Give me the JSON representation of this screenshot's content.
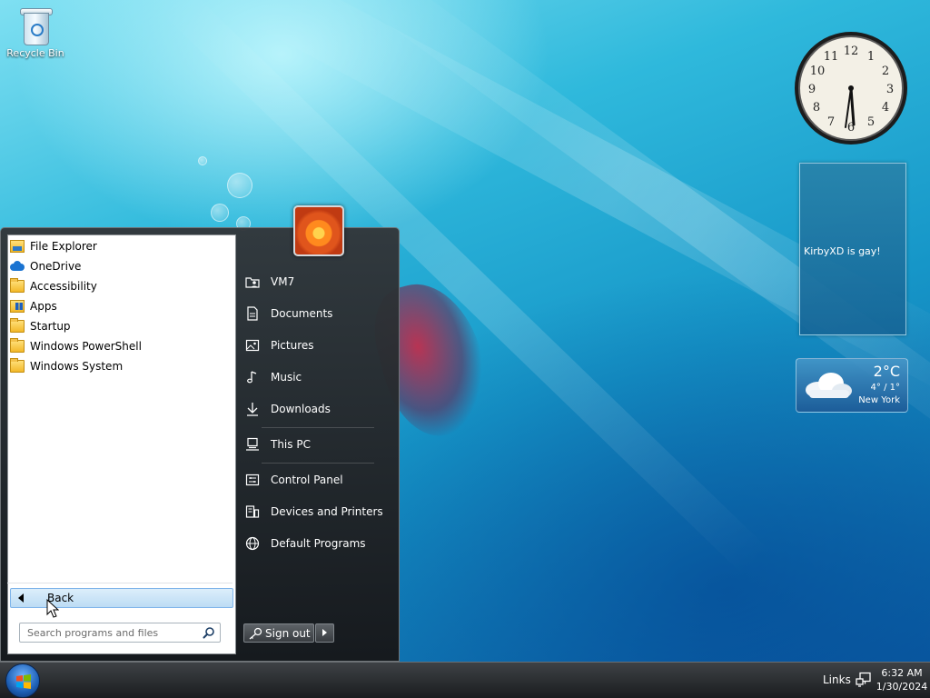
{
  "desktop": {
    "recycle_bin_label": "Recycle Bin",
    "note_text": "KirbyXD is gay!",
    "weather": {
      "temp": "2°C",
      "range": "4° / 1°",
      "city": "New York"
    }
  },
  "start_menu": {
    "programs": [
      {
        "label": "File Explorer",
        "icon": "file-explorer-icon"
      },
      {
        "label": "OneDrive",
        "icon": "onedrive-icon"
      },
      {
        "label": "Accessibility",
        "icon": "folder-icon"
      },
      {
        "label": "Apps",
        "icon": "apps-folder-icon"
      },
      {
        "label": "Startup",
        "icon": "folder-icon"
      },
      {
        "label": "Windows PowerShell",
        "icon": "folder-icon"
      },
      {
        "label": "Windows System",
        "icon": "folder-icon"
      }
    ],
    "back_label": "Back",
    "search_placeholder": "Search programs and files",
    "places": [
      {
        "label": "VM7",
        "icon": "user-folder-icon"
      },
      {
        "label": "Documents",
        "icon": "document-icon"
      },
      {
        "label": "Pictures",
        "icon": "picture-icon"
      },
      {
        "label": "Music",
        "icon": "music-note-icon"
      },
      {
        "label": "Downloads",
        "icon": "download-arrow-icon"
      },
      {
        "label": "This PC",
        "icon": "computer-icon"
      },
      {
        "label": "Control Panel",
        "icon": "control-panel-icon"
      },
      {
        "label": "Devices and Printers",
        "icon": "printer-icon"
      },
      {
        "label": "Default Programs",
        "icon": "globe-icon"
      }
    ],
    "sign_out_label": "Sign out"
  },
  "taskbar": {
    "links_label": "Links",
    "time": "6:32 AM",
    "date": "1/30/2024"
  },
  "colors": {
    "menu_bg": "#2a2d30",
    "back_highlight": "#bcdcf4",
    "desktop_accent": "#1696c8"
  }
}
